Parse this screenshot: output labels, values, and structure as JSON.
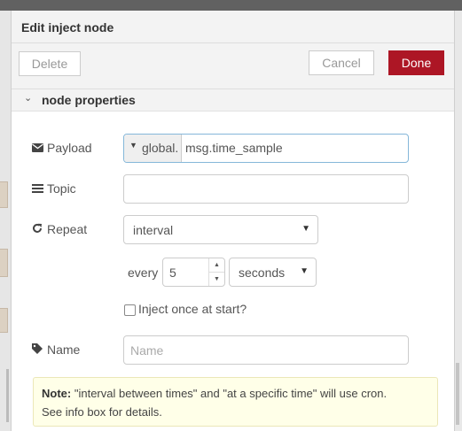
{
  "dialog": {
    "title": "Edit inject node",
    "delete_label": "Delete",
    "cancel_label": "Cancel",
    "done_label": "Done",
    "section_title": "node properties"
  },
  "form": {
    "payload": {
      "label": "Payload",
      "icon": "envelope-icon",
      "type_label": "global.",
      "value": "msg.time_sample"
    },
    "topic": {
      "label": "Topic",
      "icon": "list-icon",
      "value": ""
    },
    "repeat": {
      "label": "Repeat",
      "icon": "repeat-icon",
      "selected": "interval"
    },
    "interval": {
      "every_label": "every",
      "value": "5",
      "units": "seconds"
    },
    "inject_once": {
      "label": "Inject once at start?",
      "checked": false
    },
    "name": {
      "label": "Name",
      "icon": "tag-icon",
      "placeholder": "Name",
      "value": ""
    }
  },
  "note": {
    "bold": "Note:",
    "line1": "\"interval between times\" and \"at a specific time\" will use cron.",
    "line2": "See info box for details."
  },
  "colors": {
    "done": "#ad1625",
    "note_bg": "#ffffe8"
  }
}
